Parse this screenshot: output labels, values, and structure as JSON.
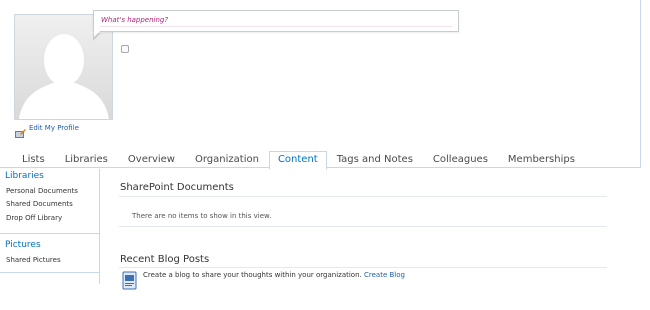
{
  "status": {
    "placeholder": "What's happening?"
  },
  "profile": {
    "edit_link": "Edit My Profile"
  },
  "tabs": [
    {
      "label": "Lists",
      "active": false
    },
    {
      "label": "Libraries",
      "active": false
    },
    {
      "label": "Overview",
      "active": false
    },
    {
      "label": "Organization",
      "active": false
    },
    {
      "label": "Content",
      "active": true
    },
    {
      "label": "Tags and Notes",
      "active": false
    },
    {
      "label": "Colleagues",
      "active": false
    },
    {
      "label": "Memberships",
      "active": false
    }
  ],
  "sidebar": {
    "libraries_heading": "Libraries",
    "libraries": [
      "Personal Documents",
      "Shared Documents",
      "Drop Off Library"
    ],
    "pictures_heading": "Pictures",
    "pictures": [
      "Shared Pictures"
    ]
  },
  "main": {
    "documents_title": "SharePoint Documents",
    "documents_empty": "There are no items to show in this view.",
    "blog_title": "Recent Blog Posts",
    "blog_prompt": "Create a blog to share your thoughts within your organization.",
    "blog_link": "Create Blog"
  },
  "colors": {
    "accent": "#0072bc",
    "link": "#1f5fa8",
    "status_text": "#b0287a",
    "border": "#c6d8ea"
  },
  "icons": {
    "avatar": "default-person-silhouette",
    "edit_profile": "edit-profile-icon",
    "blog": "blog-document-icon"
  }
}
